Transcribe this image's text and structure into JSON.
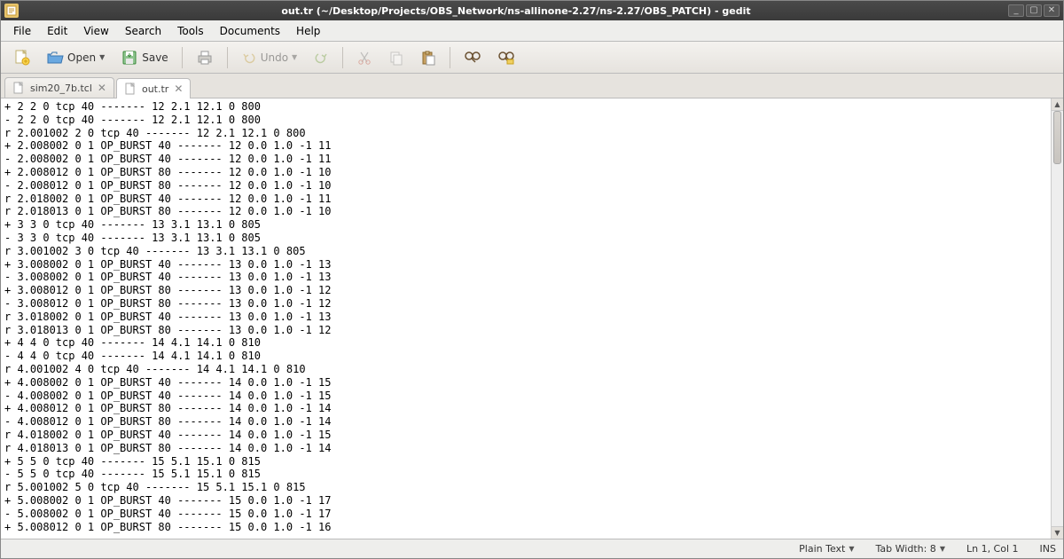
{
  "window": {
    "title": "out.tr (~/Desktop/Projects/OBS_Network/ns-allinone-2.27/ns-2.27/OBS_PATCH) - gedit"
  },
  "menubar": [
    "File",
    "Edit",
    "View",
    "Search",
    "Tools",
    "Documents",
    "Help"
  ],
  "toolbar": {
    "open": "Open",
    "save": "Save",
    "undo": "Undo"
  },
  "tabs": [
    {
      "label": "sim20_7b.tcl",
      "active": false
    },
    {
      "label": "out.tr",
      "active": true
    }
  ],
  "editor_lines": [
    "+ 2 2 0 tcp 40 ------- 12 2.1 12.1 0 800",
    "- 2 2 0 tcp 40 ------- 12 2.1 12.1 0 800",
    "r 2.001002 2 0 tcp 40 ------- 12 2.1 12.1 0 800",
    "+ 2.008002 0 1 OP_BURST 40 ------- 12 0.0 1.0 -1 11",
    "- 2.008002 0 1 OP_BURST 40 ------- 12 0.0 1.0 -1 11",
    "+ 2.008012 0 1 OP_BURST 80 ------- 12 0.0 1.0 -1 10",
    "- 2.008012 0 1 OP_BURST 80 ------- 12 0.0 1.0 -1 10",
    "r 2.018002 0 1 OP_BURST 40 ------- 12 0.0 1.0 -1 11",
    "r 2.018013 0 1 OP_BURST 80 ------- 12 0.0 1.0 -1 10",
    "+ 3 3 0 tcp 40 ------- 13 3.1 13.1 0 805",
    "- 3 3 0 tcp 40 ------- 13 3.1 13.1 0 805",
    "r 3.001002 3 0 tcp 40 ------- 13 3.1 13.1 0 805",
    "+ 3.008002 0 1 OP_BURST 40 ------- 13 0.0 1.0 -1 13",
    "- 3.008002 0 1 OP_BURST 40 ------- 13 0.0 1.0 -1 13",
    "+ 3.008012 0 1 OP_BURST 80 ------- 13 0.0 1.0 -1 12",
    "- 3.008012 0 1 OP_BURST 80 ------- 13 0.0 1.0 -1 12",
    "r 3.018002 0 1 OP_BURST 40 ------- 13 0.0 1.0 -1 13",
    "r 3.018013 0 1 OP_BURST 80 ------- 13 0.0 1.0 -1 12",
    "+ 4 4 0 tcp 40 ------- 14 4.1 14.1 0 810",
    "- 4 4 0 tcp 40 ------- 14 4.1 14.1 0 810",
    "r 4.001002 4 0 tcp 40 ------- 14 4.1 14.1 0 810",
    "+ 4.008002 0 1 OP_BURST 40 ------- 14 0.0 1.0 -1 15",
    "- 4.008002 0 1 OP_BURST 40 ------- 14 0.0 1.0 -1 15",
    "+ 4.008012 0 1 OP_BURST 80 ------- 14 0.0 1.0 -1 14",
    "- 4.008012 0 1 OP_BURST 80 ------- 14 0.0 1.0 -1 14",
    "r 4.018002 0 1 OP_BURST 40 ------- 14 0.0 1.0 -1 15",
    "r 4.018013 0 1 OP_BURST 80 ------- 14 0.0 1.0 -1 14",
    "+ 5 5 0 tcp 40 ------- 15 5.1 15.1 0 815",
    "- 5 5 0 tcp 40 ------- 15 5.1 15.1 0 815",
    "r 5.001002 5 0 tcp 40 ------- 15 5.1 15.1 0 815",
    "+ 5.008002 0 1 OP_BURST 40 ------- 15 0.0 1.0 -1 17",
    "- 5.008002 0 1 OP_BURST 40 ------- 15 0.0 1.0 -1 17",
    "+ 5.008012 0 1 OP_BURST 80 ------- 15 0.0 1.0 -1 16"
  ],
  "status": {
    "language": "Plain Text",
    "tabwidth": "Tab Width: 8",
    "position": "Ln 1, Col 1",
    "insert": "INS"
  }
}
